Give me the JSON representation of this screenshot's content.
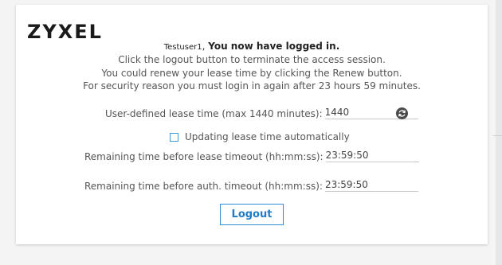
{
  "brand": {
    "logo_text": "ZYXEL"
  },
  "session": {
    "username": "Testuser1",
    "separator": ",",
    "logged_in_msg": "You now have logged in.",
    "instruction_logout": "Click the logout button to terminate the access session.",
    "instruction_renew": "You could renew your lease time by clicking the Renew button.",
    "instruction_security": "For security reason you must login in again after 23 hours 59 minutes."
  },
  "lease": {
    "label": "User-defined lease time (max 1440 minutes):",
    "value": "1440",
    "renew_icon": "refresh-icon"
  },
  "auto_update": {
    "label": "Updating lease time automatically",
    "checked": false
  },
  "timers": {
    "lease_timeout_label": "Remaining time before lease timeout (hh:mm:ss):",
    "lease_timeout_value": "23:59:50",
    "auth_timeout_label": "Remaining time before auth. timeout (hh:mm:ss):",
    "auth_timeout_value": "23:59:50"
  },
  "actions": {
    "logout_label": "Logout"
  },
  "colors": {
    "accent": "#2d8fd5",
    "text": "#555555"
  }
}
